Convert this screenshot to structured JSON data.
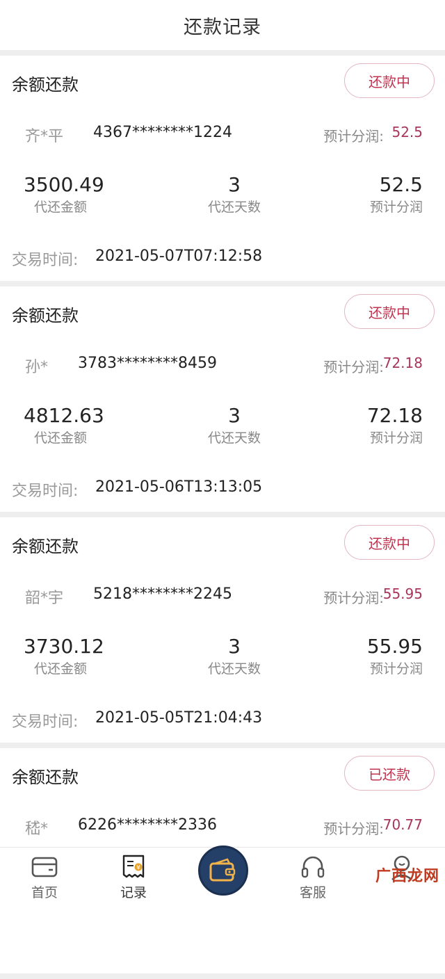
{
  "header": {
    "title": "还款记录"
  },
  "records": [
    {
      "type": "余额还款",
      "status": "还款中",
      "name": "齐*平",
      "card_no": "4367********1224",
      "share_label": "预计分润:",
      "share_value": "52.5",
      "amount": "3500.49",
      "amount_label": "代还金额",
      "days": "3",
      "days_label": "代还天数",
      "profit": "52.5",
      "profit_label": "预计分润",
      "time_label": "交易时间:",
      "time_value": "2021-05-07T07:12:58"
    },
    {
      "type": "余额还款",
      "status": "还款中",
      "name": "孙*",
      "card_no": "3783********8459",
      "share_label": "预计分润:",
      "share_value": "72.18",
      "amount": "4812.63",
      "amount_label": "代还金额",
      "days": "3",
      "days_label": "代还天数",
      "profit": "72.18",
      "profit_label": "预计分润",
      "time_label": "交易时间:",
      "time_value": "2021-05-06T13:13:05"
    },
    {
      "type": "余额还款",
      "status": "还款中",
      "name": "韶*宇",
      "card_no": "5218********2245",
      "share_label": "预计分润:",
      "share_value": "55.95",
      "amount": "3730.12",
      "amount_label": "代还金额",
      "days": "3",
      "days_label": "代还天数",
      "profit": "55.95",
      "profit_label": "预计分润",
      "time_label": "交易时间:",
      "time_value": "2021-05-05T21:04:43"
    },
    {
      "type": "余额还款",
      "status": "已还款",
      "name": "嵇*",
      "card_no": "6226********2336",
      "share_label": "预计分润:",
      "share_value": "70.77"
    }
  ],
  "tabbar": {
    "home": "首页",
    "records": "记录",
    "service": "客服",
    "center_icon": "wallet-icon"
  },
  "watermark": "广西龙网",
  "colors": {
    "accent": "#c2334f",
    "share": "#a8355b",
    "center": "#243f68"
  }
}
